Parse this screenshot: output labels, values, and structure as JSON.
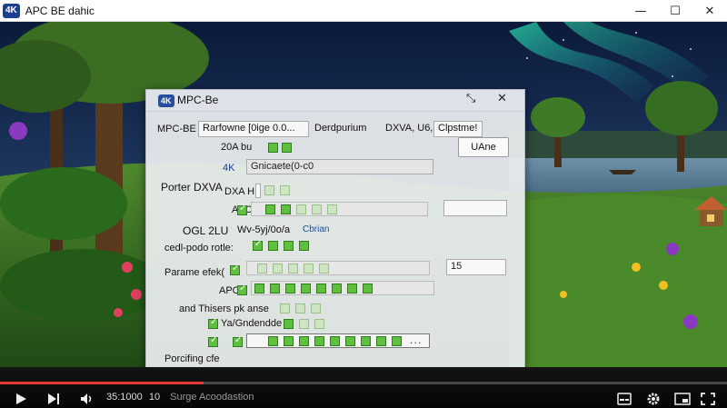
{
  "window": {
    "badge": "4K",
    "title": "APC BE dahic",
    "minimize": "—",
    "maximize": "☐",
    "close": "✕"
  },
  "dialog": {
    "badge": "4K",
    "title": "MPC-Be",
    "pin_glyph": "⤡",
    "close_glyph": "✕",
    "tabs": [
      "Rarfowne [0ige 0.0...",
      "Derdpurium",
      "DXVA, U6,",
      "Clpstme!"
    ],
    "left_label": "MPC-BE",
    "ok_button": "UAne",
    "rows": {
      "r1_label": "20A bu",
      "r2_prefix": "4K",
      "r2_field": "Gnicaete(0-c0",
      "group_label": "Porter DXVA",
      "r3_label": "DXA H",
      "r4_label": "APC",
      "r5_label": "OGL 2LU",
      "r5_value": "Wv-5yj/0o/a",
      "r5_link": "Cbrian",
      "r6_label": "cedl-podo rotle:",
      "r7_label": "Parame efek(",
      "r7_value": "15",
      "r8_label": "APC",
      "r9_label": "and Thisers pk anse",
      "r10_label": "Ya/Gndendde",
      "footer_label": "Porcifing cfe",
      "ellipsis": "..."
    }
  },
  "player": {
    "time": "35:1000",
    "time_mid": "10",
    "status": "Surge Acoodastion",
    "progress_percent": 28
  },
  "icons": {
    "play": "play-icon",
    "next": "next-icon",
    "volume": "volume-icon",
    "subtitles": "subtitles-icon",
    "settings": "gear-icon",
    "miniplayer": "miniplayer-icon",
    "fullscreen": "fullscreen-icon"
  },
  "colors": {
    "badge": "#1c3f8f",
    "checkbox": "#5fbf3f",
    "seek": "#e53935"
  }
}
